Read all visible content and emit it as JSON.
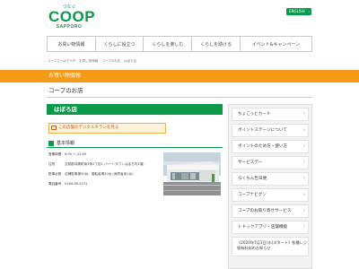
{
  "header": {
    "logo_kana": "つなぐ",
    "logo_main": "COOP",
    "logo_sub": "SAPPORO",
    "english_label": "ENGLISH",
    "english_arrow": "›"
  },
  "nav": [
    "お買い物情報",
    "くらしに役立つ",
    "くらしを楽しむ",
    "くらしを助ける",
    "イベント&キャンペーン"
  ],
  "breadcrumb": [
    "コープさっぽろTOP",
    "お買い物情報",
    "コープのお店",
    "はぼろ店"
  ],
  "page": {
    "category": "お買い物情報",
    "section_title": "コープのお店",
    "store_name": "はぼろ店",
    "flyer_button": "この店舗のデジタルチラシを見る",
    "basic_info_label": "基本情報"
  },
  "info": [
    {
      "k": "営業時間",
      "v": "9:00 ～ 22:00"
    },
    {
      "k": "住所",
      "v": "苫前郡羽幌町南3条2丁目1 (ハートタウンはぼろ内1階)"
    },
    {
      "k": "駐車台数",
      "v": "店舗駐車場50台、運転者場20台 (身障者用1台)"
    },
    {
      "k": "電話番号",
      "v": "0164-69-5151"
    }
  ],
  "sidebar": [
    "ちょこっとカード",
    "ポイントステージについて",
    "ポイントのため方・使い方",
    "サービスデー",
    "らくちん告日便",
    "コープナビゲン",
    "コープのお取り寄せサービス",
    "トドックアプリ・店舗機能",
    "《2020年7月1日(水)スタート》各種レジ袋有料化のお知らせ"
  ],
  "chevron": "›",
  "colors": {
    "brand_green": "#0a9a4a",
    "orange": "#f49a17"
  }
}
